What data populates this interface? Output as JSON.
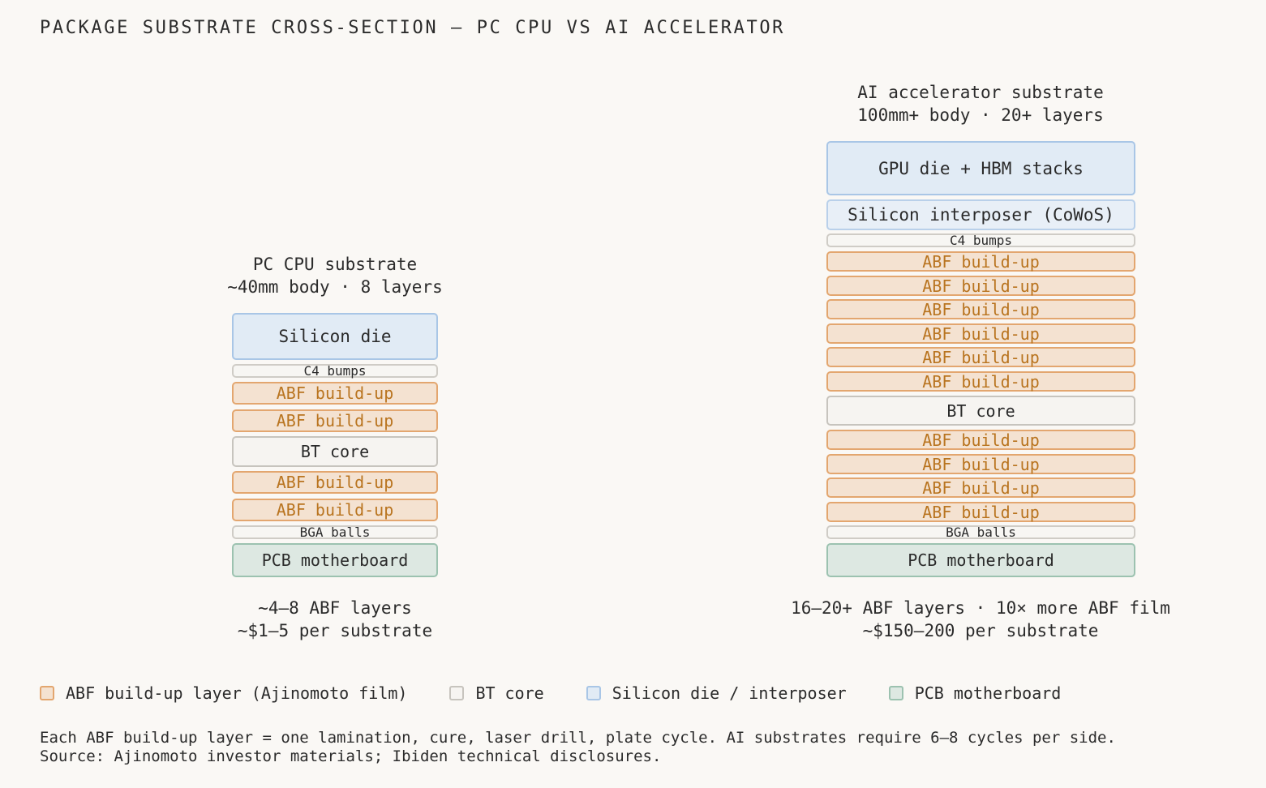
{
  "title": "PACKAGE SUBSTRATE CROSS-SECTION — PC CPU VS AI ACCELERATOR",
  "pc": {
    "title_line1": "PC CPU substrate",
    "title_line2": "~40mm body · 8 layers",
    "layers": [
      "Silicon die",
      "C4 bumps",
      "ABF build-up",
      "ABF build-up",
      "BT core",
      "ABF build-up",
      "ABF build-up",
      "BGA balls",
      "PCB motherboard"
    ],
    "caption_line1": "~4–8 ABF layers",
    "caption_line2": "~$1–5 per substrate"
  },
  "ai": {
    "title_line1": "AI accelerator substrate",
    "title_line2": "100mm+ body · 20+ layers",
    "layers": [
      "GPU die + HBM stacks",
      "Silicon interposer (CoWoS)",
      "C4 bumps",
      "ABF build-up",
      "ABF build-up",
      "ABF build-up",
      "ABF build-up",
      "ABF build-up",
      "ABF build-up",
      "BT core",
      "ABF build-up",
      "ABF build-up",
      "ABF build-up",
      "ABF build-up",
      "BGA balls",
      "PCB motherboard"
    ],
    "caption_line1": "16–20+ ABF layers · 10× more ABF film",
    "caption_line2": "~$150–200 per substrate"
  },
  "legend": [
    {
      "label": "ABF build-up layer (Ajinomoto film)",
      "color": "#f4e2d1",
      "border": "#e3a66f"
    },
    {
      "label": "BT core",
      "color": "#f6f4f1",
      "border": "#c7c4be"
    },
    {
      "label": "Silicon die / interposer",
      "color": "#e1ebf5",
      "border": "#a9c6e6"
    },
    {
      "label": "PCB motherboard",
      "color": "#dde8e2",
      "border": "#9cc2b0"
    }
  ],
  "footnote_line1": "Each ABF build-up layer = one lamination, cure, laser drill, plate cycle. AI substrates require 6–8 cycles per side.",
  "footnote_line2": "Source: Ajinomoto investor materials; Ibiden technical disclosures."
}
